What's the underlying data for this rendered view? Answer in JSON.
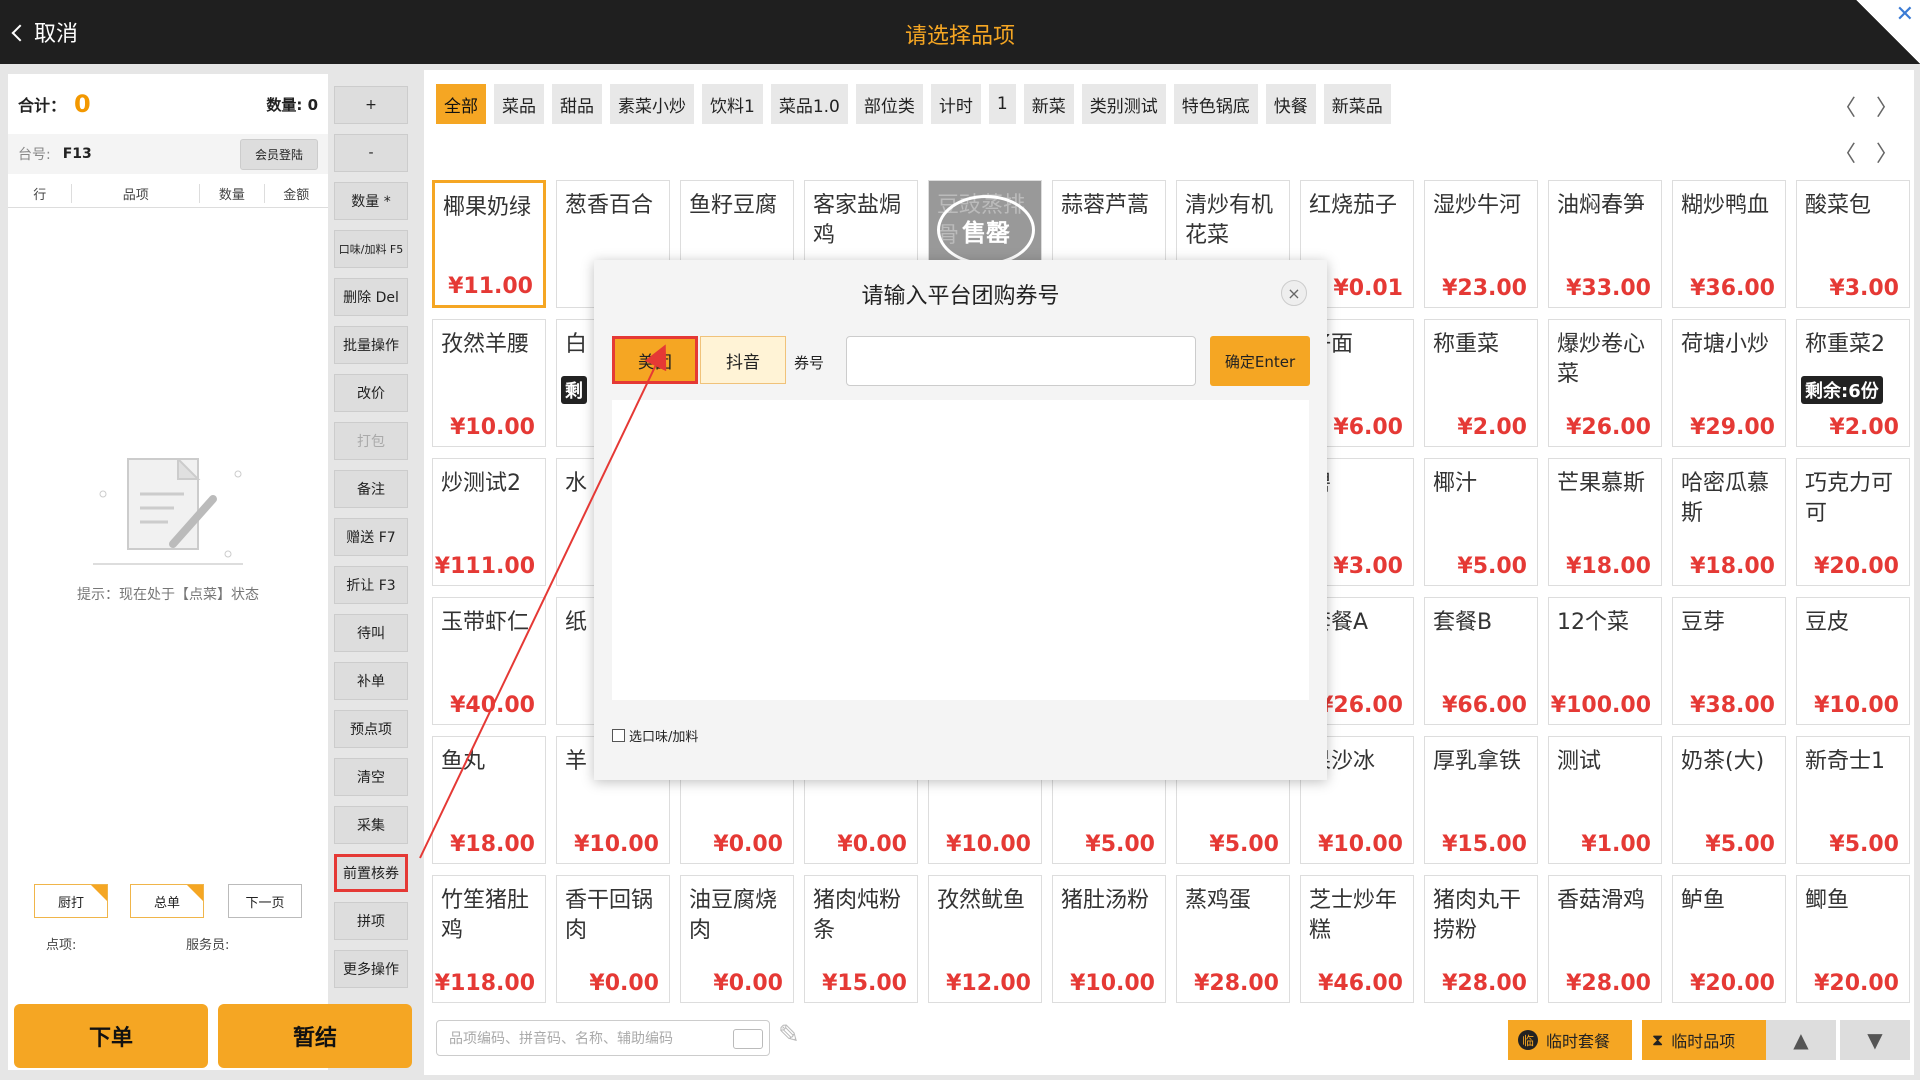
{
  "titlebar": {
    "cancel_label": "取消",
    "title": "请选择品项"
  },
  "left_panel": {
    "total_label": "合计：",
    "total_value": "0",
    "qty_label": "数量:",
    "qty_value": "0",
    "table_label": "台号:",
    "table_value": "F13",
    "member_login": "会员登陆",
    "columns": [
      "行",
      "品项",
      "数量",
      "金额"
    ],
    "hint": "提示：现在处于【点菜】状态",
    "item_label": "点项:",
    "waiter_label": "服务员:",
    "btn_kitchen": "厨打",
    "btn_total": "总单",
    "btn_next_page": "下一页",
    "order_button": "下单",
    "hold_button": "暂结"
  },
  "ops": [
    "+",
    "-",
    "数量 *",
    "口味/加料 F5",
    "删除 Del",
    "批量操作",
    "改价",
    "打包",
    "备注",
    "赠送 F7",
    "折让 F3",
    "待叫",
    "补单",
    "预点项",
    "清空",
    "采集",
    "前置核券",
    "拼项",
    "更多操作"
  ],
  "categories": [
    "全部",
    "菜品",
    "甜品",
    "素菜小炒",
    "饮料1",
    "菜品1.0",
    "部位类",
    "计时",
    "1",
    "新菜",
    "类别测试",
    "特色锅底",
    "快餐",
    "新菜品"
  ],
  "nav": {
    "prev": "〈",
    "next": "〉"
  },
  "products": [
    [
      {
        "name": "椰果奶绿",
        "price": "¥11.00"
      },
      {
        "name": "葱香百合",
        "price": "¥"
      },
      {
        "name": "鱼籽豆腐",
        "price": ""
      },
      {
        "name": "客家盐焗鸡",
        "price": ""
      },
      {
        "name": "豆豉蒸排骨",
        "price": "",
        "soldout": "售罄"
      },
      {
        "name": "蒜蓉芦蒿",
        "price": ""
      },
      {
        "name": "清炒有机花菜",
        "price": ""
      },
      {
        "name": "红烧茄子",
        "price": "¥0.01"
      },
      {
        "name": "湿炒牛河",
        "price": "¥23.00"
      },
      {
        "name": "油焖春笋",
        "price": "¥33.00"
      },
      {
        "name": "糊炒鸭血",
        "price": "¥36.00"
      },
      {
        "name": "酸菜包",
        "price": "¥3.00"
      }
    ],
    [
      {
        "name": "孜然羊腰",
        "price": "¥10.00"
      },
      {
        "name": "白",
        "price": "",
        "remain": "剩"
      },
      {
        "name": "",
        "price": ""
      },
      {
        "name": "",
        "price": ""
      },
      {
        "name": "",
        "price": ""
      },
      {
        "name": "",
        "price": ""
      },
      {
        "name": "",
        "price": ""
      },
      {
        "name": "仔面",
        "price": "¥6.00"
      },
      {
        "name": "称重菜",
        "price": "¥2.00"
      },
      {
        "name": "爆炒卷心菜",
        "price": "¥26.00"
      },
      {
        "name": "荷塘小炒",
        "price": "¥29.00"
      },
      {
        "name": "称重菜2",
        "price": "¥2.00",
        "remain": "剩余:6份"
      }
    ],
    [
      {
        "name": "炒测试2",
        "price": "¥111.00"
      },
      {
        "name": "水",
        "price": ""
      },
      {
        "name": "",
        "price": ""
      },
      {
        "name": "",
        "price": ""
      },
      {
        "name": "",
        "price": ""
      },
      {
        "name": "",
        "price": ""
      },
      {
        "name": "",
        "price": ""
      },
      {
        "name": "碧",
        "price": "¥3.00"
      },
      {
        "name": "椰汁",
        "price": "¥5.00"
      },
      {
        "name": "芒果慕斯",
        "price": "¥18.00"
      },
      {
        "name": "哈密瓜慕斯",
        "price": "¥18.00"
      },
      {
        "name": "巧克力可可",
        "price": "¥20.00"
      }
    ],
    [
      {
        "name": "玉带虾仁",
        "price": "¥40.00"
      },
      {
        "name": "纸",
        "price": "¥"
      },
      {
        "name": "",
        "price": ""
      },
      {
        "name": "",
        "price": ""
      },
      {
        "name": "",
        "price": ""
      },
      {
        "name": "",
        "price": ""
      },
      {
        "name": "",
        "price": ""
      },
      {
        "name": "套餐A",
        "price": "¥26.00"
      },
      {
        "name": "套餐B",
        "price": "¥66.00"
      },
      {
        "name": "12个菜",
        "price": "¥100.00"
      },
      {
        "name": "豆芽",
        "price": "¥38.00"
      },
      {
        "name": "豆皮",
        "price": "¥10.00"
      }
    ],
    [
      {
        "name": "鱼丸",
        "price": "¥18.00"
      },
      {
        "name": "羊",
        "price": "¥10.00"
      },
      {
        "name": "",
        "price": "¥0.00"
      },
      {
        "name": "",
        "price": "¥0.00"
      },
      {
        "name": "",
        "price": "¥10.00"
      },
      {
        "name": "",
        "price": "¥5.00"
      },
      {
        "name": "",
        "price": "¥5.00"
      },
      {
        "name": "果沙冰",
        "price": "¥10.00"
      },
      {
        "name": "厚乳拿铁",
        "price": "¥15.00"
      },
      {
        "name": "测试",
        "price": "¥1.00"
      },
      {
        "name": "奶茶(大)",
        "price": "¥5.00"
      },
      {
        "name": "新奇士1",
        "price": "¥5.00"
      }
    ],
    [
      {
        "name": "竹笙猪肚鸡",
        "price": "¥118.00"
      },
      {
        "name": "香干回锅肉",
        "price": "¥0.00"
      },
      {
        "name": "油豆腐烧肉",
        "price": "¥0.00"
      },
      {
        "name": "猪肉炖粉条",
        "price": "¥15.00"
      },
      {
        "name": "孜然鱿鱼",
        "price": "¥12.00"
      },
      {
        "name": "猪肚汤粉",
        "price": "¥10.00"
      },
      {
        "name": "蒸鸡蛋",
        "price": "¥28.00"
      },
      {
        "name": "芝士炒年糕",
        "price": "¥46.00"
      },
      {
        "name": "猪肉丸干捞粉",
        "price": "¥28.00"
      },
      {
        "name": "香菇滑鸡",
        "price": "¥28.00"
      },
      {
        "name": "鲈鱼",
        "price": "¥20.00"
      },
      {
        "name": "鲫鱼",
        "price": "¥20.00"
      }
    ]
  ],
  "search_placeholder": "品项编码、拼音码、名称、辅助编码",
  "bottom": {
    "temp_set": "临时套餐",
    "temp_item": "临时品项",
    "up": "▲",
    "down": "▼"
  },
  "modal": {
    "title": "请输入平台团购券号",
    "close": "×",
    "meituan": "美团",
    "douyin": "抖音",
    "coupon_label": "券号",
    "confirm": "确定Enter",
    "check_label": "选口味/加料"
  },
  "colors": {
    "accent": "#f5a623",
    "price": "#e53935",
    "titlebar": "#1f1f1f"
  }
}
